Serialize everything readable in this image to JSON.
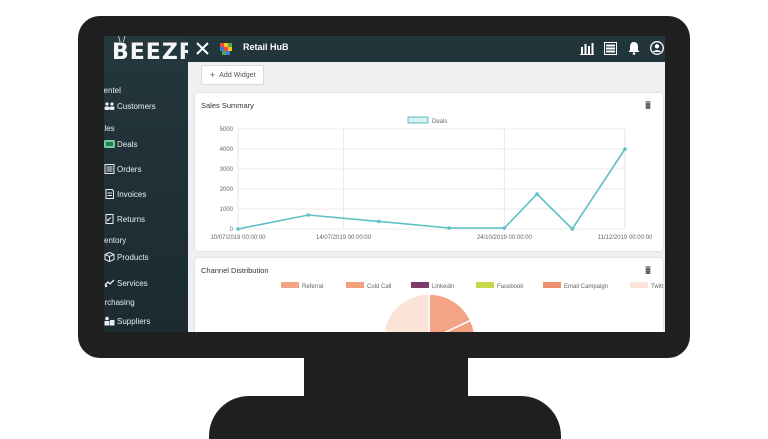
{
  "app": {
    "logo": "BEEZR",
    "title": "Retail HuB"
  },
  "sidebar": {
    "sections": [
      {
        "label": "lientel"
      },
      {
        "label": "ales"
      },
      {
        "label": "ventory"
      },
      {
        "label": "urchasing"
      }
    ],
    "items": [
      {
        "label": "Customers",
        "icon": "customers-icon"
      },
      {
        "label": "Deals",
        "icon": "deals-icon"
      },
      {
        "label": "Orders",
        "icon": "orders-icon"
      },
      {
        "label": "Invoices",
        "icon": "invoices-icon"
      },
      {
        "label": "Returns",
        "icon": "returns-icon"
      },
      {
        "label": "Products",
        "icon": "products-icon"
      },
      {
        "label": "Services",
        "icon": "services-icon"
      },
      {
        "label": "Suppliers",
        "icon": "suppliers-icon"
      }
    ]
  },
  "toolbar": {
    "add_widget_label": "Add Widget",
    "icons": [
      "chart-icon",
      "list-icon",
      "bell-icon",
      "user-icon"
    ]
  },
  "widgets": {
    "sales_summary_title": "Sales Summary",
    "channel_distribution_title": "Channel Distribution"
  },
  "chart_data": [
    {
      "type": "line",
      "series": [
        {
          "name": "Deals",
          "color": "#5bc0c4",
          "values": [
            0,
            700,
            380,
            50,
            50,
            1750,
            0,
            4000
          ]
        }
      ],
      "x": [
        "2019-07-10",
        "2019-08-07",
        "2019-09-04",
        "2019-10-02",
        "2019-10-24",
        "2019-11-06",
        "2019-11-20",
        "2019-12-11"
      ],
      "x_ticks": [
        "10/07/2019 00:00:00",
        "14/07/2019 00:00:00",
        "24/10/2019 00:00:00",
        "11/12/2019 00:00:00"
      ],
      "y_ticks": [
        "0",
        "1000",
        "2000",
        "3000",
        "4000",
        "5000"
      ],
      "ylim": [
        0,
        5000
      ],
      "grid": true,
      "legend": "top-center"
    },
    {
      "type": "pie",
      "legend": "top-center",
      "labels": [
        "Referral",
        "Cold Call",
        "Linkedin",
        "Facebook",
        "Email Campaign",
        "Twitter"
      ],
      "colors": [
        "#f4a486",
        "#f3a07e",
        "#7b3b6b",
        "#c6d94a",
        "#ee8f6d",
        "#fbe3d8"
      ],
      "values": [
        18,
        32,
        0,
        0,
        28,
        22
      ]
    }
  ]
}
